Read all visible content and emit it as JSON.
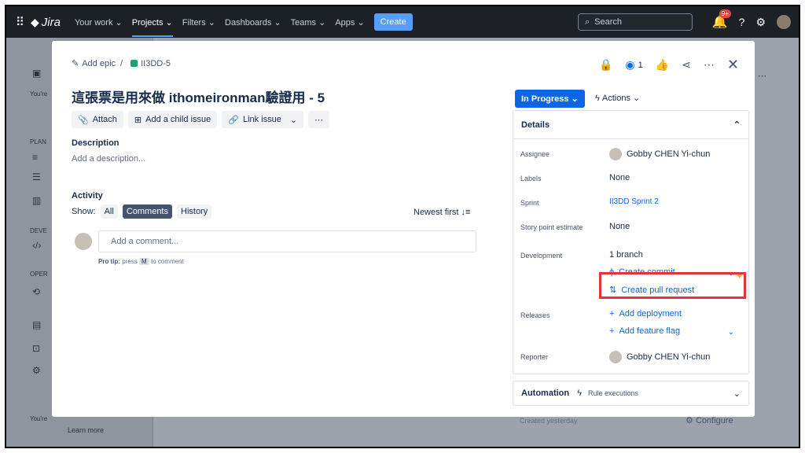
{
  "nav": {
    "logo_text": "Jira",
    "items": [
      "Your work",
      "Projects",
      "Filters",
      "Dashboards",
      "Teams",
      "Apps"
    ],
    "create_label": "Create",
    "search_placeholder": "Search",
    "notif_badge": "9+"
  },
  "sidebar": {
    "youre_text": "You're",
    "plan_text": "PLAN",
    "dev_text": "DEVE",
    "oper_text": "OPER",
    "youre_bottom": "You're",
    "learn_more": "Learn more"
  },
  "issue": {
    "breadcrumb_epic": "Add epic",
    "breadcrumb_key": "II3DD-5",
    "watch_count": "1",
    "title": "這張票是用來做 ithomeironman驗證用 - 5",
    "buttons": {
      "attach": "Attach",
      "child": "Add a child issue",
      "link": "Link issue"
    },
    "description_heading": "Description",
    "description_placeholder": "Add a description...",
    "activity_heading": "Activity",
    "show_label": "Show:",
    "show_all": "All",
    "show_comments": "Comments",
    "show_history": "History",
    "sort_label": "Newest first",
    "comment_placeholder": "Add a comment...",
    "protip_label": "Pro tip:",
    "protip_press": "press",
    "protip_key": "M",
    "protip_rest": "to comment"
  },
  "right": {
    "status": "In Progress",
    "actions": "Actions",
    "details_heading": "Details",
    "assignee_label": "Assignee",
    "assignee_value": "Gobby CHEN Yi-chun",
    "labels_label": "Labels",
    "labels_value": "None",
    "sprint_label": "Sprint",
    "sprint_value": "II3DD Sprint 2",
    "story_label": "Story point estimate",
    "story_value": "None",
    "development_label": "Development",
    "development_value": "1 branch",
    "create_commit": "Create commit",
    "create_pr": "Create pull request",
    "releases_label": "Releases",
    "add_deployment": "Add deployment",
    "add_flag": "Add feature flag",
    "reporter_label": "Reporter",
    "reporter_value": "Gobby CHEN Yi-chun",
    "automation_label": "Automation",
    "automation_sub": "Rule executions",
    "created_text": "Created yesterday",
    "configure_text": "Configure"
  },
  "colors": {
    "primary": "#0c66e4",
    "highlight": "#e5323b",
    "nav_bg": "#1d2125"
  }
}
